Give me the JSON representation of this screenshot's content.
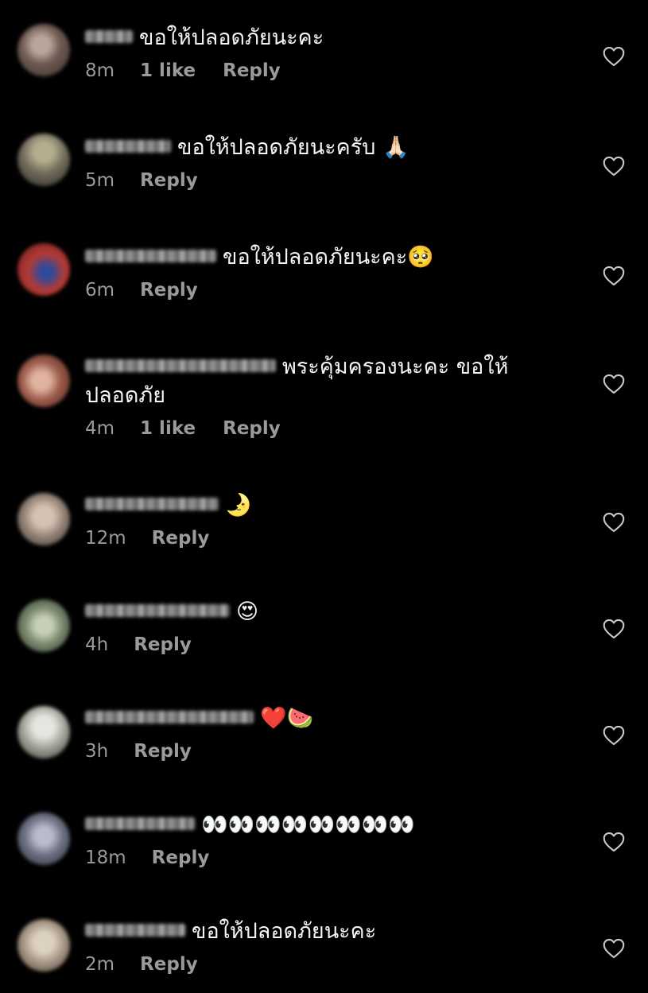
{
  "comments": [
    {
      "time": "8m",
      "likes": "1 like",
      "text": "ขอให้ปลอดภัยนะคะ",
      "reply": "Reply",
      "avatar_color": "#6e5a52"
    },
    {
      "time": "5m",
      "likes": "",
      "text": "ขอให้ปลอดภัยนะครับ 🙏🏻",
      "reply": "Reply",
      "avatar_color": "#6f6a5a"
    },
    {
      "time": "6m",
      "likes": "",
      "text": "ขอให้ปลอดภัยนะคะ🥺",
      "reply": "Reply",
      "avatar_color": "#b23a35"
    },
    {
      "time": "4m",
      "likes": "1 like",
      "text": "พระคุ้มครองนะคะ ขอให้ปลอดภัย",
      "reply": "Reply",
      "avatar_color": "#9c5a4a"
    },
    {
      "time": "12m",
      "likes": "",
      "text": "🌛",
      "reply": "Reply",
      "avatar_color": "#8c7c70"
    },
    {
      "time": "4h",
      "likes": "",
      "text": "😍",
      "reply": "Reply",
      "avatar_color": "#7a8a70"
    },
    {
      "time": "3h",
      "likes": "",
      "text": "❤️🍉",
      "reply": "Reply",
      "avatar_color": "#9a9a92"
    },
    {
      "time": "18m",
      "likes": "",
      "text": "👀👀👀👀👀👀👀👀",
      "reply": "Reply",
      "avatar_color": "#6a6e80"
    },
    {
      "time": "2m",
      "likes": "",
      "text": "ขอให้ปลอดภัยนะคะ",
      "reply": "Reply",
      "avatar_color": "#a09080"
    }
  ],
  "icons": {
    "like": "heart-outline-icon"
  }
}
